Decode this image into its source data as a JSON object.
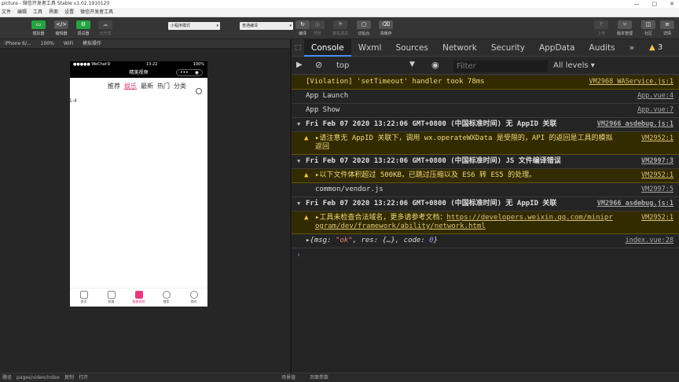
{
  "window": {
    "title": "picture - 微信开发者工具 Stable v1.02.1910120",
    "controls": [
      "—",
      "□",
      "✕"
    ]
  },
  "menu": [
    "文件",
    "编辑",
    "工具",
    "界面",
    "设置",
    "微信开发者工具"
  ],
  "toolbar": {
    "left_buttons": [
      {
        "label": "模拟器",
        "icon": "phone-icon",
        "glyph": "▭",
        "green": true
      },
      {
        "label": "编辑器",
        "icon": "code-icon",
        "glyph": "</>",
        "green": false
      },
      {
        "label": "调试器",
        "icon": "bug-icon",
        "glyph": "⚙",
        "green": true
      },
      {
        "label": "云开发",
        "icon": "cloud-icon",
        "glyph": "☁",
        "green": false
      }
    ],
    "mode_select": "小程序模式",
    "compile_select": "普通编译",
    "mid_buttons": [
      {
        "label": "编译",
        "icon": "compile-icon",
        "glyph": "↻",
        "dim": false
      },
      {
        "label": "预览",
        "icon": "preview-icon",
        "glyph": "◎",
        "dim": true
      },
      {
        "label": "真机调试",
        "icon": "remote-debug-icon",
        "glyph": "⚑",
        "dim": true
      },
      {
        "label": "切后台",
        "icon": "background-icon",
        "glyph": "▢",
        "dim": false
      },
      {
        "label": "清缓存",
        "icon": "clear-cache-icon",
        "glyph": "⌫",
        "dim": false
      }
    ],
    "right_buttons": [
      {
        "label": "上传",
        "icon": "upload-icon",
        "glyph": "↑",
        "dim": true
      },
      {
        "label": "版本管理",
        "icon": "version-icon",
        "glyph": "⑂",
        "dim": false
      },
      {
        "label": "社区",
        "icon": "community-icon",
        "glyph": "◫",
        "dim": false
      },
      {
        "label": "详情",
        "icon": "details-icon",
        "glyph": "≡",
        "dim": false
      }
    ]
  },
  "simulator": {
    "device": "iPhone 6/...",
    "zoom": "100%",
    "network": "WiFi",
    "op": "模拟操作",
    "phone": {
      "status_left": "●●●●● WeChat令",
      "status_time": "13:22",
      "status_battery": "100%",
      "nav_title": "精美视频",
      "tabs": [
        "推荐",
        "娱乐",
        "最新",
        "热门",
        "分类"
      ],
      "body_text": "1-4",
      "tabbar": [
        {
          "label": "首页",
          "icon": "home-icon"
        },
        {
          "label": "频道",
          "icon": "image-icon"
        },
        {
          "label": "精美视频",
          "icon": "video-icon"
        },
        {
          "label": "搜索",
          "icon": "search-icon"
        },
        {
          "label": "我的",
          "icon": "user-icon"
        }
      ]
    }
  },
  "devtools": {
    "tabs": [
      "Console",
      "Wxml",
      "Sources",
      "Network",
      "Security",
      "AppData",
      "Audits"
    ],
    "more": "»",
    "warn_count": "3",
    "context": "top",
    "filter_placeholder": "Filter",
    "levels": "All levels ▾",
    "lines": [
      {
        "kind": "warn-plain",
        "text": "[Violation] 'setTimeout' handler took 78ms",
        "src": "VM2968 WAService.js:1"
      },
      {
        "kind": "log",
        "text": "App Launch",
        "src": "App.vue:4"
      },
      {
        "kind": "log",
        "text": "App Show",
        "src": "App.vue:7"
      },
      {
        "kind": "group",
        "text": "Fri Feb 07 2020 13:22:06 GMT+0800 (中国标准时间) 无 AppID 关联",
        "src": "VM2966 asdebug.js:1"
      },
      {
        "kind": "warn",
        "text": "▸请注意无 AppID 关联下，调用 wx.operateWXData 是受限的，API 的返回是工具的模拟返回",
        "src": "VM2952:1"
      },
      {
        "kind": "group",
        "text": "Fri Feb 07 2020 13:22:06 GMT+0800 (中国标准时间) JS 文件编译错误",
        "src": "VM2997:3"
      },
      {
        "kind": "warn",
        "text": "▸以下文件体积超过 500KB，已跳过压缩以及 ES6 转 ES5 的处理。",
        "src": "VM2952:1"
      },
      {
        "kind": "log-indent",
        "text": "common/vendor.js",
        "src": "VM2997:5"
      },
      {
        "kind": "group",
        "text": "Fri Feb 07 2020 13:22:06 GMT+0800 (中国标准时间) 无 AppID 关联",
        "src": "VM2966 asdebug.js:1"
      },
      {
        "kind": "warn-link",
        "text": "▸工具未检查合法域名，更多请参考文档：",
        "link": "https://developers.weixin.qq.com/miniprogram/dev/framework/ability/network.html",
        "src": "VM2952:1"
      }
    ],
    "obj_line": {
      "prefix": "▸{msg: ",
      "msg": "\"ok\"",
      "mid": ", res: {…}, code: ",
      "code": "0",
      "suffix": "}",
      "src": "index.vue:28"
    },
    "prompt": "›"
  },
  "statusbar": [
    "路径",
    "pages/video/index",
    "复制",
    "打开",
    "场景值",
    "页面参数"
  ]
}
